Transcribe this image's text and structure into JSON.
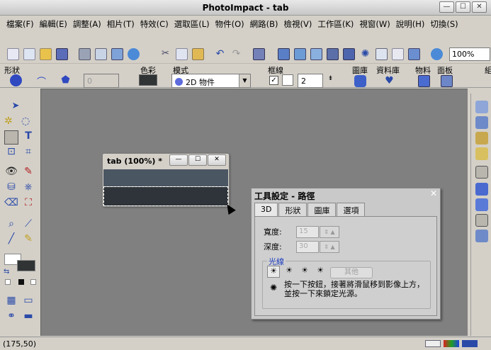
{
  "app": {
    "title": "PhotoImpact - tab"
  },
  "menu": [
    "檔案(F)",
    "編輯(E)",
    "調整(A)",
    "相片(T)",
    "特效(C)",
    "選取區(L)",
    "物件(O)",
    "網路(B)",
    "檢視(V)",
    "工作區(K)",
    "視窗(W)",
    "說明(H)",
    "切換(S)"
  ],
  "toolbar": {
    "zoom": "100%"
  },
  "attributes": {
    "shape_label": "形狀",
    "color_label": "色彩",
    "mode_label": "模式",
    "mode_value": "2D 物件",
    "border_label": "框線",
    "border_width": "2",
    "gallery_label": "圖庫",
    "library_label": "資料庫",
    "material_label": "物料",
    "panel_label": "面板",
    "cut_label": "組"
  },
  "document": {
    "title": "tab (100%) *"
  },
  "tool_panel": {
    "title": "工具設定 - 路徑",
    "tabs": [
      "3D",
      "形狀",
      "圖庫",
      "選項"
    ],
    "active_tab": "3D",
    "width_label": "寬度:",
    "width_value": "15",
    "depth_label": "深度:",
    "depth_value": "30",
    "light_group": "光線",
    "other_button": "其他",
    "hint": "按一下按鈕，接著將滑鼠移到影像上方，並按一下來鎖定光源。"
  },
  "status": {
    "coords": "(175,50)"
  }
}
